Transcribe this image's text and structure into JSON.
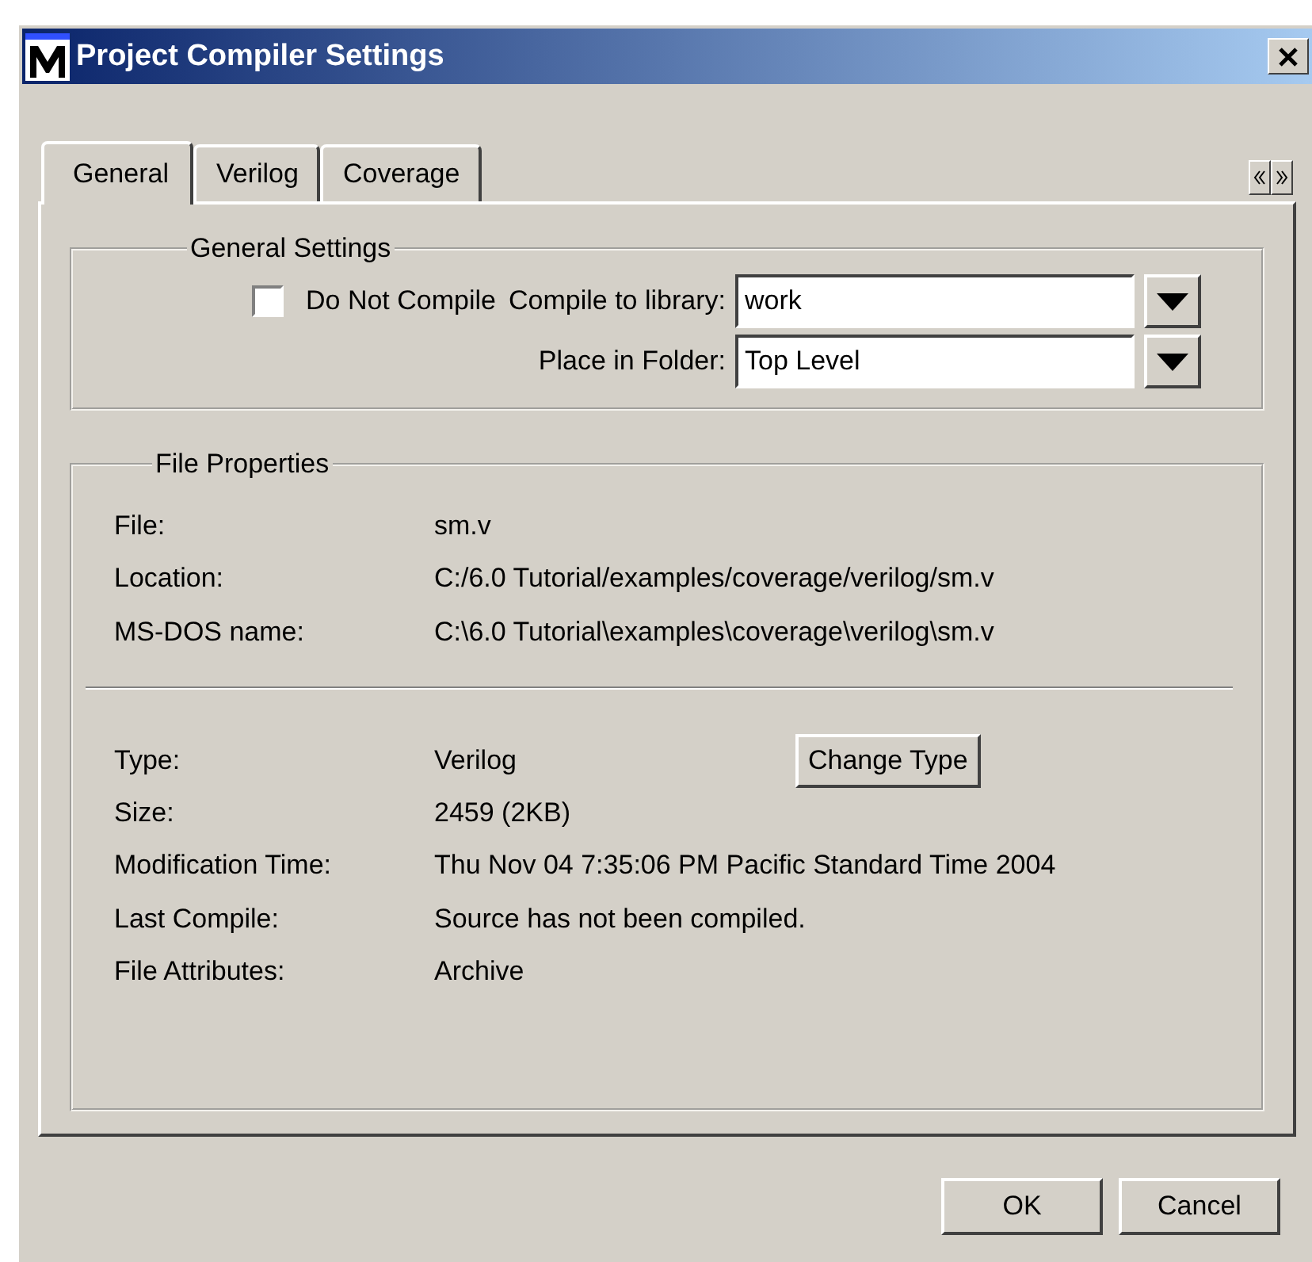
{
  "window": {
    "title": "Project Compiler Settings"
  },
  "tabs": [
    {
      "label": "General",
      "selected": true
    },
    {
      "label": "Verilog",
      "selected": false
    },
    {
      "label": "Coverage",
      "selected": false
    }
  ],
  "general_settings": {
    "title": "General Settings",
    "do_not_compile": {
      "label": "Do Not Compile",
      "checked": false
    },
    "fields": [
      {
        "label": "Compile to library:",
        "value": "work"
      },
      {
        "label": "Place in Folder:",
        "value": "Top Level"
      }
    ]
  },
  "file_properties": {
    "title": "File Properties",
    "paths": [
      {
        "label": "File:",
        "value": "sm.v"
      },
      {
        "label": "Location:",
        "value": "C:/6.0 Tutorial/examples/coverage/verilog/sm.v"
      },
      {
        "label": "MS-DOS name:",
        "value": "C:\\6.0 Tutorial\\examples\\coverage\\verilog\\sm.v"
      }
    ],
    "details": [
      {
        "label": "Type:",
        "value": "Verilog",
        "button": "Change Type"
      },
      {
        "label": "Size:",
        "value": "2459 (2KB)"
      },
      {
        "label": "Modification Time:",
        "value": "Thu Nov 04 7:35:06 PM Pacific Standard Time 2004"
      },
      {
        "label": "Last Compile:",
        "value": "Source has not been compiled."
      },
      {
        "label": "File Attributes:",
        "value": "Archive"
      }
    ]
  },
  "buttons": [
    "OK",
    "Cancel"
  ]
}
